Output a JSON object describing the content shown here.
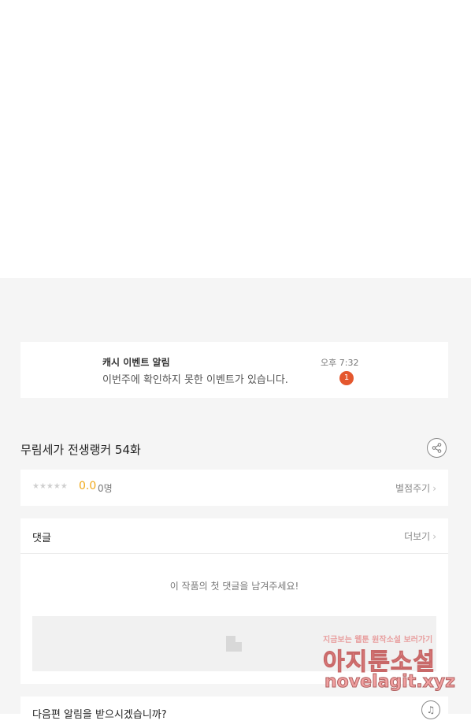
{
  "notification": {
    "title": "캐시 이벤트 알림",
    "message": "이번주에 확인하지 못한 이벤트가 있습니다.",
    "time": "오후 7:32",
    "badge": "1"
  },
  "episode": {
    "title": "무림세가 전생랭커 54화",
    "share_icon": "share-icon"
  },
  "rating": {
    "stars": "★★★★★",
    "score": "0.0",
    "count": "0명",
    "action_label": "별점주기",
    "chevron": "›"
  },
  "comments": {
    "header": "댓글",
    "more_label": "더보기",
    "chevron": "›",
    "empty_text": "이 작품의 첫 댓글을 남겨주세요!"
  },
  "next_alert": {
    "text": "다음편 알림을 받으시겠습니까?",
    "bell_icon": "bell-icon"
  },
  "watermark": {
    "line1": "지금보는 웹툰 원작소설 보러가기",
    "line2": "아지툰소설",
    "line3": "novelagit.xyz"
  },
  "colors": {
    "accent_score": "#f0a818",
    "badge": "#e4572e",
    "page_bg": "#f5f5f5"
  }
}
